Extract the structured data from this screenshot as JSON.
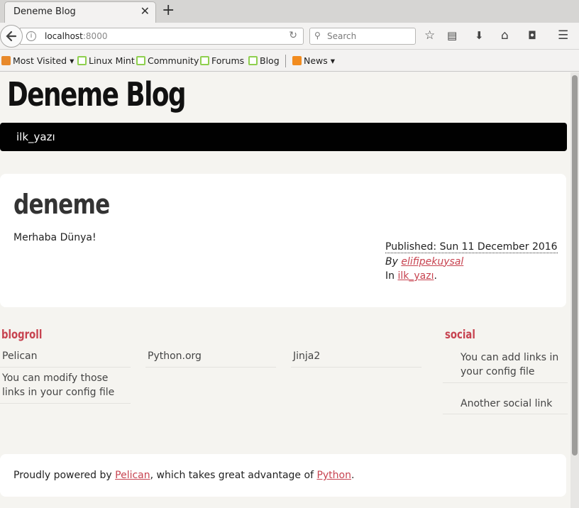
{
  "browser": {
    "tab_title": "Deneme Blog",
    "url_host": "localhost",
    "url_port": ":8000",
    "search_placeholder": "Search",
    "bookmarks": [
      {
        "label": "Most Visited"
      },
      {
        "label": "Linux Mint"
      },
      {
        "label": "Community"
      },
      {
        "label": "Forums"
      },
      {
        "label": "Blog"
      },
      {
        "label": "News"
      }
    ],
    "toolbar_icons": [
      "bookmark-star-icon",
      "reading-list-icon",
      "download-icon",
      "home-icon",
      "pocket-icon",
      "hamburger-menu-icon"
    ]
  },
  "site": {
    "title": "Deneme Blog",
    "menu": [
      {
        "label": "ilk_yazı"
      }
    ]
  },
  "article": {
    "title": "deneme",
    "body": "Merhaba Dünya!",
    "published": "Published: Sun 11 December 2016",
    "by_prefix": "By",
    "author": "elifipekuysal",
    "in_prefix": "In",
    "category": "ilk_yazı",
    "in_suffix": "."
  },
  "blogroll": {
    "heading": "blogroll",
    "links": [
      "Pelican",
      "Python.org",
      "Jinja2",
      "You can modify those links in your config file"
    ]
  },
  "social": {
    "heading": "social",
    "links": [
      "You can add links in your config file",
      "Another social link"
    ]
  },
  "footer": {
    "prefix": "Proudly powered by",
    "pelican": "Pelican",
    "middle": ", which takes great advantage of",
    "python": "Python",
    "suffix": "."
  },
  "colors": {
    "accent": "#c74350",
    "menu_bg": "#010101",
    "page_bg": "#f5f4f0"
  }
}
